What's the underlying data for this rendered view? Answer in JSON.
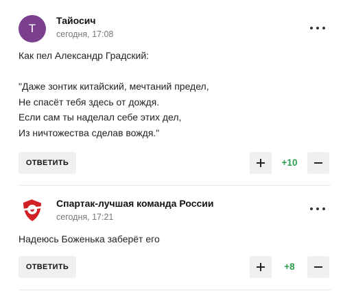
{
  "comments": [
    {
      "avatar_letter": "Т",
      "avatar_color": "#7b3f8e",
      "author": "Тайосич",
      "time": "сегодня, 17:08",
      "text": "Как пел Александр Градский:\n\n\"Даже зонтик китайский, мечтаний предел,\nНе спасёт тебя здесь от дождя.\nЕсли сам ты наделал себе этих дел,\nИз ничтожества сделав вождя.\"",
      "reply_label": "ОТВЕТИТЬ",
      "score": "+10"
    },
    {
      "avatar_icon": "spartak-logo-icon",
      "author": "Спартак-лучшая команда России",
      "time": "сегодня, 17:21",
      "text": "Надеюсь Боженька заберёт его",
      "reply_label": "ОТВЕТИТЬ",
      "score": "+8"
    }
  ],
  "colors": {
    "score_positive": "#2a9d4e",
    "button_bg": "#f0f0f0",
    "meta_text": "#777777"
  }
}
